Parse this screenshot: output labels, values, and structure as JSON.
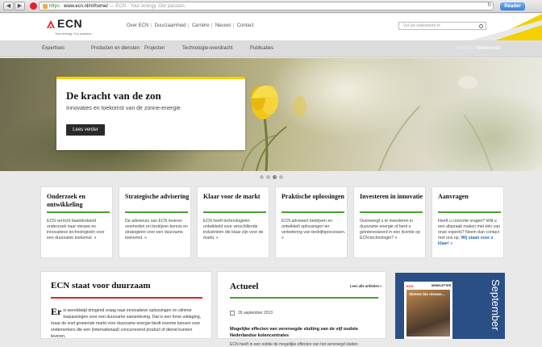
{
  "browser": {
    "url_scheme": "https",
    "url_host": "www.ecn.nl",
    "url_path": "/nl/home/",
    "page_title": "— ECN - Your energy. Our passion.",
    "reader_label": "Reader"
  },
  "header": {
    "logo_text": "ECN",
    "tagline": "Your energy. Our passion.",
    "links": [
      "Over ECN",
      "Duurzaamheid",
      "Carrière",
      "Nieuws",
      "Contact"
    ],
    "search_placeholder": "Vul uw zoekwoord in"
  },
  "nav": {
    "items": [
      "Expertises",
      "Producten en diensten",
      "Projecten",
      "Technologie-overdracht",
      "Publicaties"
    ],
    "lang_en": "English",
    "lang_sep": "/",
    "lang_nl": "Nederlands"
  },
  "hero": {
    "title": "De kracht van de zon",
    "subtitle": "Innovaties en toekomst van de zonne-energie",
    "button": "Lees verder",
    "slide_count": 4,
    "active_slide": 2
  },
  "cards": [
    {
      "title": "Onderzoek en ontwikkeling",
      "text": "ECN verricht baanbrekend onderzoek naar nieuwe en innovatieve technologieën voor een duurzame toekomst.",
      "more": "»",
      "accent": "#4a9b36"
    },
    {
      "title": "Strategische advisering",
      "text": "De adviseurs van ECN leveren overheden en bedrijven kennis en strategieën voor een duurzame toekomst.",
      "more": "»",
      "accent": "#4a9b36"
    },
    {
      "title": "Klaar voor de markt",
      "text": "ECN heeft technologieën ontwikkeld voor verschillende industrieën die klaar zijn voor de markt.",
      "more": "»",
      "accent": "#4a9b36"
    },
    {
      "title": "Praktische oplossingen",
      "text": "ECN adviseert bedrijven en ontwikkelt oplossingen ter verbetering van bedrijfsprocessen.",
      "more": "»",
      "accent": "#4a9b36"
    },
    {
      "title": "Investeren in innovatie",
      "text": "Overweegt u te investeren in duurzame energie of bent u geïnteresseerd in een licentie op ECN-technologie?",
      "more": "»",
      "accent": "#4a9b36"
    },
    {
      "title": "Aanvragen",
      "text": "Heeft u concrete vragen? Wilt u een afspraak maken met één van onze experts? Neem dan contact met ons op.",
      "more": "Wij staan voor u klaar! »",
      "accent": "#4a9b36"
    }
  ],
  "duurzaam": {
    "title": "ECN staat voor duurzaam",
    "dropcap": "Er",
    "text": " is wereldwijd dringend vraag naar innovatieve oplossingen en slimme toepassingen voor een duurzame samenleving. Dat is een forse uitdaging, maar de snel groeiende markt voor duurzame energie biedt enorme kansen voor ondernemers die een (internationaal) concurrerend product of dienst kunnen leveren."
  },
  "actueel": {
    "title": "Actueel",
    "all_articles": "Lees alle artikelen »",
    "date": "26 september 2013",
    "news_title": "Mogelijke effecten van vervroegde sluiting van de vijf oudste Nederlandse kolencentrales",
    "news_body": "ECN heeft in een notitie de mogelijke effecten van het vervroegd sluiten"
  },
  "newsletter": {
    "brand": "ECN",
    "label": "NEWSLETTER",
    "headline": "Slimme bio nieuwe...",
    "month": "September"
  },
  "colors": {
    "brand_red": "#e2212a",
    "accent_yellow": "#f4d000",
    "accent_green": "#4a9b36",
    "link_blue": "#2a6bb3"
  }
}
